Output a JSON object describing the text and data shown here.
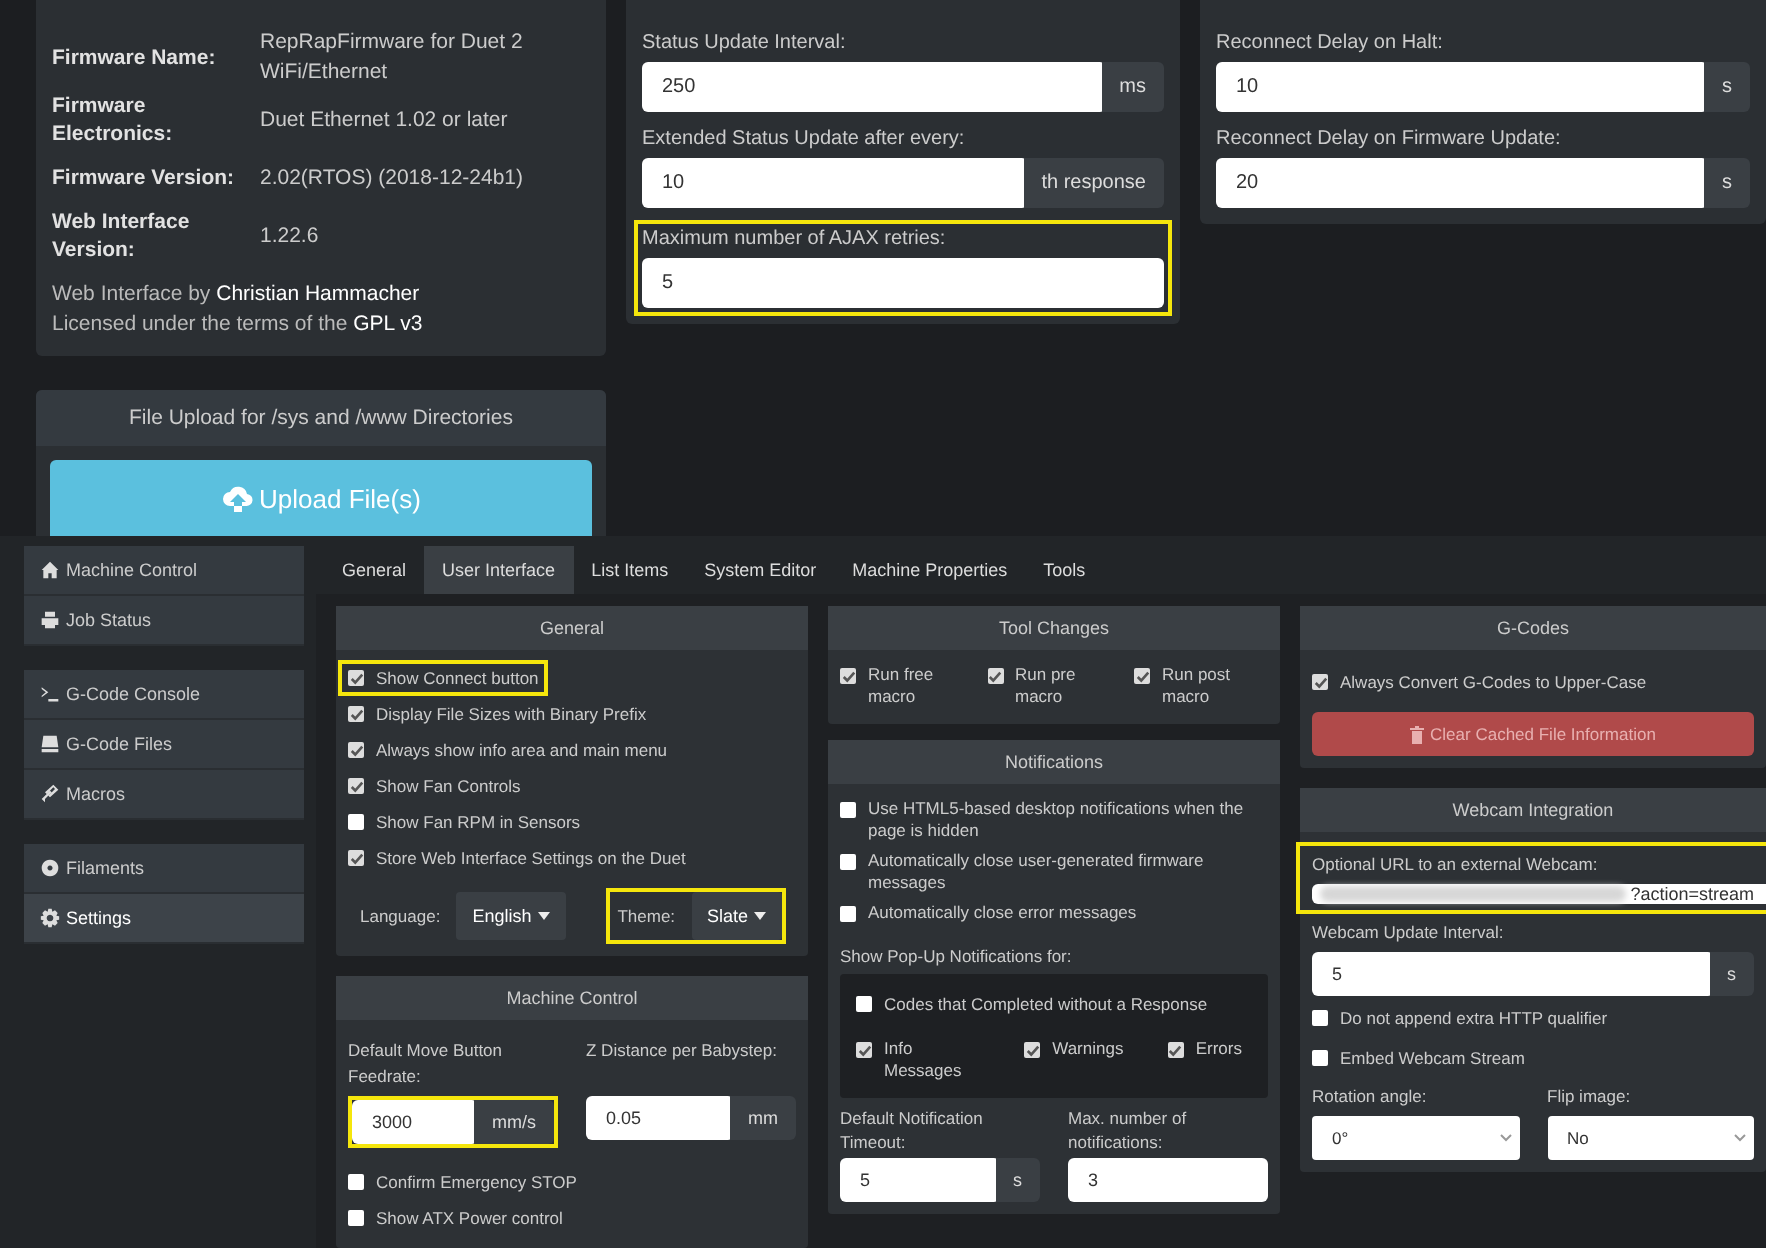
{
  "firmware_info": {
    "rows": [
      {
        "label": "Firmware Name:",
        "value": "RepRapFirmware for Duet 2 WiFi/Ethernet"
      },
      {
        "label": "Firmware Electronics:",
        "value": "Duet Ethernet 1.02 or later"
      },
      {
        "label": "Firmware Version:",
        "value": "2.02(RTOS) (2018-12-24b1)"
      },
      {
        "label": "Web Interface Version:",
        "value": "1.22.6"
      }
    ],
    "credit": "Web Interface by **Christian Hammacher**",
    "license": "Licensed under the terms of the **GPL v3**"
  },
  "file_upload": {
    "title": "File Upload for /sys and /www Directories",
    "button": "Upload File(s)"
  },
  "communication": {
    "fields": [
      {
        "label": "Status Update Interval:",
        "value": "250",
        "unit": "ms",
        "highlighted": false
      },
      {
        "label": "Extended Status Update after every:",
        "value": "10",
        "unit": "th response",
        "highlighted": false
      },
      {
        "label": "Maximum number of AJAX retries:",
        "value": "5",
        "highlighted": true
      }
    ]
  },
  "reconnect": {
    "fields": [
      {
        "label": "Reconnect Delay on Halt:",
        "value": "10",
        "unit": "s"
      },
      {
        "label": "Reconnect Delay on Firmware Update:",
        "value": "20",
        "unit": "s"
      }
    ]
  },
  "sidebar": {
    "groups": [
      {
        "items": [
          {
            "label": "Machine Control",
            "selected": false
          },
          {
            "label": "Job Status",
            "selected": false
          }
        ]
      },
      {
        "items": [
          {
            "label": "G-Code Console",
            "selected": false
          },
          {
            "label": "G-Code Files",
            "selected": false
          },
          {
            "label": "Macros",
            "selected": false
          }
        ]
      },
      {
        "items": [
          {
            "label": "Filaments",
            "selected": false
          },
          {
            "label": "Settings",
            "selected": true
          }
        ]
      }
    ]
  },
  "tabs": [
    {
      "label": "General",
      "selected": false
    },
    {
      "label": "User Interface",
      "selected": true
    },
    {
      "label": "List Items",
      "selected": false
    },
    {
      "label": "System Editor",
      "selected": false
    },
    {
      "label": "Machine Properties",
      "selected": false
    },
    {
      "label": "Tools",
      "selected": false
    }
  ],
  "general": {
    "title": "General",
    "options": [
      {
        "label": "Show Connect button",
        "checked": true,
        "highlighted": true
      },
      {
        "label": "Display File Sizes with Binary Prefix",
        "checked": true,
        "highlighted": false
      },
      {
        "label": "Always show info area and main menu",
        "checked": true,
        "highlighted": false
      },
      {
        "label": "Show Fan Controls",
        "checked": true,
        "highlighted": false
      },
      {
        "label": "Show Fan RPM in Sensors",
        "checked": false,
        "highlighted": false
      },
      {
        "label": "Store Web Interface Settings on the Duet",
        "checked": true,
        "highlighted": false
      }
    ],
    "language": {
      "label": "Language:",
      "value": "English",
      "highlighted": false
    },
    "theme": {
      "label": "Theme:",
      "value": "Slate",
      "highlighted": true
    }
  },
  "machine_control": {
    "title": "Machine Control",
    "feedrate": {
      "label": "Default Move Button Feedrate:",
      "value": "3000",
      "unit": "mm/s",
      "highlighted": true
    },
    "babystep": {
      "label": "Z Distance per Babystep:",
      "value": "0.05",
      "unit": "mm",
      "highlighted": false
    },
    "options": [
      {
        "label": "Confirm Emergency STOP",
        "checked": false
      },
      {
        "label": "Show ATX Power control",
        "checked": false
      }
    ]
  },
  "tool_changes": {
    "title": "Tool Changes",
    "options": [
      {
        "label": "Run free macro",
        "checked": true
      },
      {
        "label": "Run pre macro",
        "checked": true
      },
      {
        "label": "Run post macro",
        "checked": true
      }
    ]
  },
  "notifications": {
    "title": "Notifications",
    "options": [
      {
        "label": "Use HTML5-based desktop notifications when the page is hidden",
        "checked": false
      },
      {
        "label": "Automatically close user-generated firmware messages",
        "checked": false
      },
      {
        "label": "Automatically close error messages",
        "checked": false
      }
    ],
    "popup": {
      "label": "Show Pop-Up Notifications for:",
      "options": [
        {
          "label": "Codes that Completed without a Response",
          "checked": false
        }
      ],
      "types": [
        {
          "label": "Info Messages",
          "checked": true
        },
        {
          "label": "Warnings",
          "checked": true
        },
        {
          "label": "Errors",
          "checked": true
        }
      ]
    },
    "timeout": {
      "label": "Default Notification Timeout:",
      "value": "5",
      "unit": "s"
    },
    "max": {
      "label": "Max. number of notifications:",
      "value": "3"
    }
  },
  "gcodes": {
    "title": "G-Codes",
    "options": [
      {
        "label": "Always Convert G-Codes to Upper-Case",
        "checked": true
      }
    ],
    "button": "Clear Cached File Information"
  },
  "webcam": {
    "title": "Webcam Integration",
    "url": {
      "label": "Optional URL to an external Webcam:",
      "value": "?action=stream",
      "highlighted": true
    },
    "interval": {
      "label": "Webcam Update Interval:",
      "value": "5",
      "unit": "s"
    },
    "options": [
      {
        "label": "Do not append extra HTTP qualifier",
        "checked": false
      },
      {
        "label": "Embed Webcam Stream",
        "checked": false
      }
    ],
    "rotation": {
      "label": "Rotation angle:",
      "value": "0°"
    },
    "flip": {
      "label": "Flip image:",
      "value": "No"
    }
  }
}
